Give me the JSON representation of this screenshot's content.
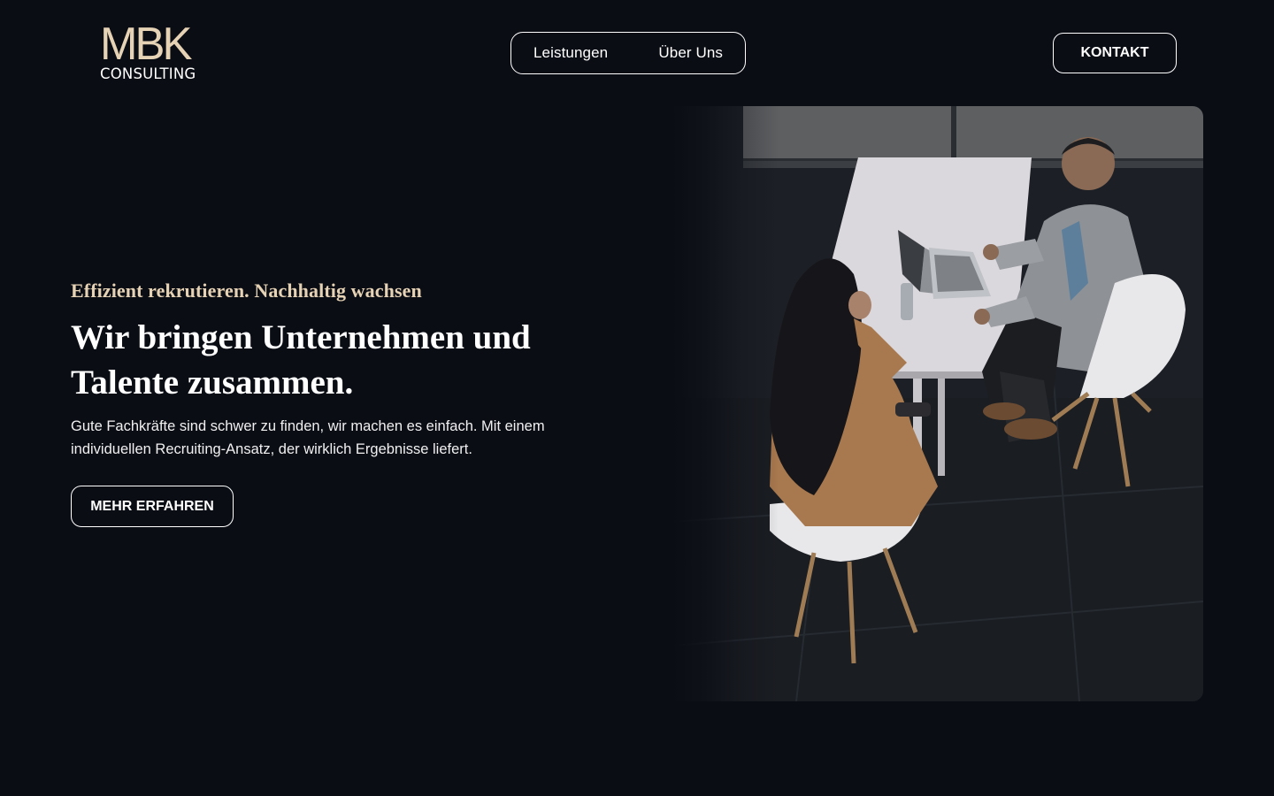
{
  "header": {
    "logo": {
      "mark": "MBK",
      "sub": "CONSULTING"
    },
    "nav": [
      {
        "label": "Leistungen"
      },
      {
        "label": "Über Uns"
      }
    ],
    "contact_label": "KONTAKT"
  },
  "hero": {
    "eyebrow": "Effizient rekrutieren. Nachhaltig wachsen",
    "headline_line1": "Wir bringen Unternehmen und",
    "headline_line2": "Talente zusammen.",
    "body_line1": "Gute Fachkräfte sind schwer zu finden, wir machen es einfach. Mit einem",
    "body_line2": "individuellen Recruiting-Ansatz, der wirklich Ergebnisse liefert.",
    "cta_label": "MEHR ERFAHREN"
  },
  "colors": {
    "background": "#0b0d15",
    "accent": "#e6d2b4",
    "text": "#ffffff"
  }
}
